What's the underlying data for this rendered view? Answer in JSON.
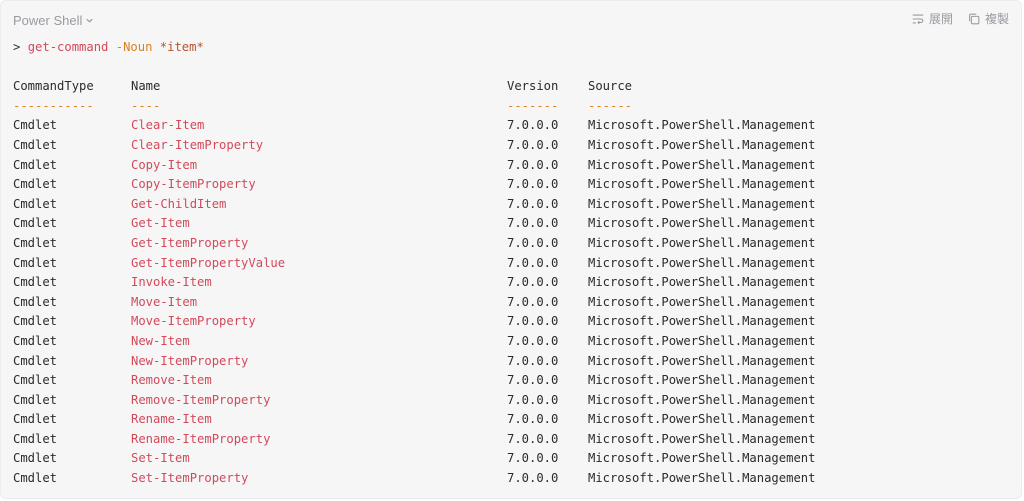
{
  "toolbar": {
    "language": "Power Shell",
    "expand_label": "展開",
    "copy_label": "複製"
  },
  "command": {
    "prompt": ">",
    "verb": "get-command",
    "param": "-Noun",
    "argument": "*item*"
  },
  "table": {
    "headers": [
      "CommandType",
      "Name",
      "Version",
      "Source"
    ],
    "underlines": [
      "-----------",
      "----",
      "-------",
      "------"
    ],
    "rows": [
      {
        "type": "Cmdlet",
        "name": "Clear-Item",
        "version": "7.0.0.0",
        "source": "Microsoft.PowerShell.Management"
      },
      {
        "type": "Cmdlet",
        "name": "Clear-ItemProperty",
        "version": "7.0.0.0",
        "source": "Microsoft.PowerShell.Management"
      },
      {
        "type": "Cmdlet",
        "name": "Copy-Item",
        "version": "7.0.0.0",
        "source": "Microsoft.PowerShell.Management"
      },
      {
        "type": "Cmdlet",
        "name": "Copy-ItemProperty",
        "version": "7.0.0.0",
        "source": "Microsoft.PowerShell.Management"
      },
      {
        "type": "Cmdlet",
        "name": "Get-ChildItem",
        "version": "7.0.0.0",
        "source": "Microsoft.PowerShell.Management"
      },
      {
        "type": "Cmdlet",
        "name": "Get-Item",
        "version": "7.0.0.0",
        "source": "Microsoft.PowerShell.Management"
      },
      {
        "type": "Cmdlet",
        "name": "Get-ItemProperty",
        "version": "7.0.0.0",
        "source": "Microsoft.PowerShell.Management"
      },
      {
        "type": "Cmdlet",
        "name": "Get-ItemPropertyValue",
        "version": "7.0.0.0",
        "source": "Microsoft.PowerShell.Management"
      },
      {
        "type": "Cmdlet",
        "name": "Invoke-Item",
        "version": "7.0.0.0",
        "source": "Microsoft.PowerShell.Management"
      },
      {
        "type": "Cmdlet",
        "name": "Move-Item",
        "version": "7.0.0.0",
        "source": "Microsoft.PowerShell.Management"
      },
      {
        "type": "Cmdlet",
        "name": "Move-ItemProperty",
        "version": "7.0.0.0",
        "source": "Microsoft.PowerShell.Management"
      },
      {
        "type": "Cmdlet",
        "name": "New-Item",
        "version": "7.0.0.0",
        "source": "Microsoft.PowerShell.Management"
      },
      {
        "type": "Cmdlet",
        "name": "New-ItemProperty",
        "version": "7.0.0.0",
        "source": "Microsoft.PowerShell.Management"
      },
      {
        "type": "Cmdlet",
        "name": "Remove-Item",
        "version": "7.0.0.0",
        "source": "Microsoft.PowerShell.Management"
      },
      {
        "type": "Cmdlet",
        "name": "Remove-ItemProperty",
        "version": "7.0.0.0",
        "source": "Microsoft.PowerShell.Management"
      },
      {
        "type": "Cmdlet",
        "name": "Rename-Item",
        "version": "7.0.0.0",
        "source": "Microsoft.PowerShell.Management"
      },
      {
        "type": "Cmdlet",
        "name": "Rename-ItemProperty",
        "version": "7.0.0.0",
        "source": "Microsoft.PowerShell.Management"
      },
      {
        "type": "Cmdlet",
        "name": "Set-Item",
        "version": "7.0.0.0",
        "source": "Microsoft.PowerShell.Management"
      },
      {
        "type": "Cmdlet",
        "name": "Set-ItemProperty",
        "version": "7.0.0.0",
        "source": "Microsoft.PowerShell.Management"
      }
    ]
  },
  "colors": {
    "background": "#f6f6f7",
    "name_red": "#d14a5a",
    "param_orange": "#d9821f",
    "muted": "#9a9aa0"
  },
  "icons": {
    "language_chevron": "chevron-down-icon",
    "expand": "wrap-lines-icon",
    "copy": "copy-icon"
  }
}
